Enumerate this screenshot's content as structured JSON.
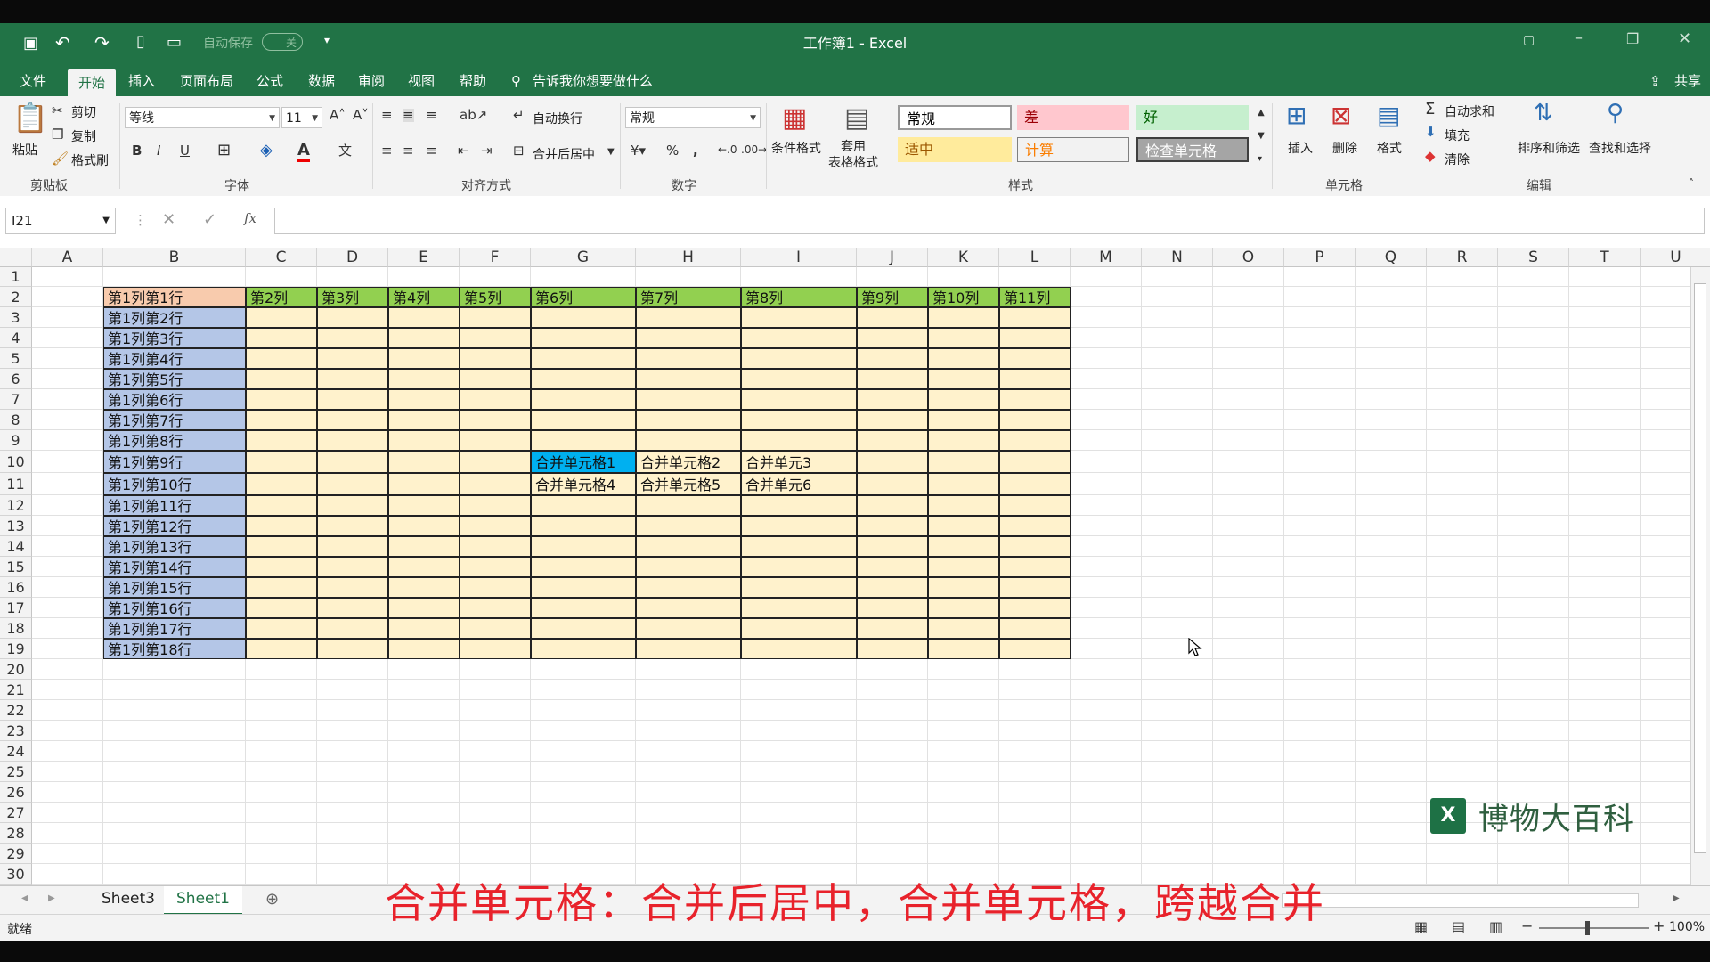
{
  "titlebar": {
    "autosave_label": "自动保存",
    "autosave_state": "关",
    "title": "工作簿1  -  Excel"
  },
  "menu": {
    "items": [
      "文件",
      "开始",
      "插入",
      "页面布局",
      "公式",
      "数据",
      "审阅",
      "视图",
      "帮助"
    ],
    "tell_me": "告诉我你想要做什么",
    "share": "共享"
  },
  "ribbon": {
    "clipboard": {
      "paste": "粘贴",
      "cut": "剪切",
      "copy": "复制",
      "format_painter": "格式刷",
      "group": "剪贴板"
    },
    "font": {
      "name": "等线",
      "size": "11",
      "group": "字体",
      "bold": "B",
      "italic": "I",
      "underline": "U"
    },
    "alignment": {
      "wrap": "自动换行",
      "merge": "合并后居中",
      "group": "对齐方式"
    },
    "number": {
      "format": "常规",
      "group": "数字",
      "percent": "%",
      "comma": ","
    },
    "styles": {
      "conditional": "条件格式",
      "table": "套用\n表格格式",
      "group": "样式",
      "cells": [
        {
          "label": "常规",
          "bg": "#ffffff",
          "fg": "#000000"
        },
        {
          "label": "差",
          "bg": "#ffc7ce",
          "fg": "#9c0006"
        },
        {
          "label": "好",
          "bg": "#c6efce",
          "fg": "#006100"
        },
        {
          "label": "适中",
          "bg": "#ffeb9c",
          "fg": "#9c5700"
        },
        {
          "label": "计算",
          "bg": "#f2f2f2",
          "fg": "#fa7d00"
        },
        {
          "label": "检查单元格",
          "bg": "#a5a5a5",
          "fg": "#ffffff"
        }
      ]
    },
    "cells": {
      "insert": "插入",
      "delete": "删除",
      "format": "格式",
      "group": "单元格"
    },
    "editing": {
      "autosum": "自动求和",
      "fill": "填充",
      "clear": "清除",
      "sort": "排序和筛选",
      "find": "查找和选择",
      "group": "编辑"
    }
  },
  "formula_bar": {
    "name_box": "I21",
    "fx": "fx",
    "value": ""
  },
  "grid": {
    "columns": [
      "A",
      "B",
      "C",
      "D",
      "E",
      "F",
      "G",
      "H",
      "I",
      "J",
      "K",
      "L",
      "M",
      "N",
      "O",
      "P",
      "Q",
      "R",
      "S",
      "T",
      "U"
    ],
    "rows": [
      "1",
      "2",
      "3",
      "4",
      "5",
      "6",
      "7",
      "8",
      "9",
      "10",
      "11",
      "12",
      "13",
      "14",
      "15",
      "16",
      "17",
      "18",
      "19",
      "20",
      "21",
      "22",
      "23",
      "24",
      "25",
      "26",
      "27",
      "28",
      "29",
      "30"
    ],
    "header_row": [
      "第2列",
      "第3列",
      "第4列",
      "第5列",
      "第6列",
      "第7列",
      "第8列",
      "第9列",
      "第10列",
      "第11列"
    ],
    "first_col": [
      "第1列第1行",
      "第1列第2行",
      "第1列第3行",
      "第1列第4行",
      "第1列第5行",
      "第1列第6行",
      "第1列第7行",
      "第1列第8行",
      "第1列第9行",
      "第1列第10行",
      "第1列第11行",
      "第1列第12行",
      "第1列第13行",
      "第1列第14行",
      "第1列第15行",
      "第1列第16行",
      "第1列第17行",
      "第1列第18行"
    ],
    "merge_row10": [
      "合并单元格1",
      "合并单元格2",
      "合并单元3"
    ],
    "merge_row11": [
      "合并单元格4",
      "合并单元格5",
      "合并单元6"
    ],
    "colors": {
      "corner": "#f8cbad",
      "header": "#92d050",
      "first_col": "#b4c6e7",
      "body": "#fff2cc",
      "selected": "#00b0f0"
    }
  },
  "sheets": {
    "tabs": [
      "Sheet3",
      "Sheet1"
    ],
    "active": "Sheet1"
  },
  "status": {
    "ready": "就绪",
    "zoom": "100%"
  },
  "caption": "合并单元格：合并后居中，合并单元格，跨越合并",
  "watermark": "博物大百科"
}
